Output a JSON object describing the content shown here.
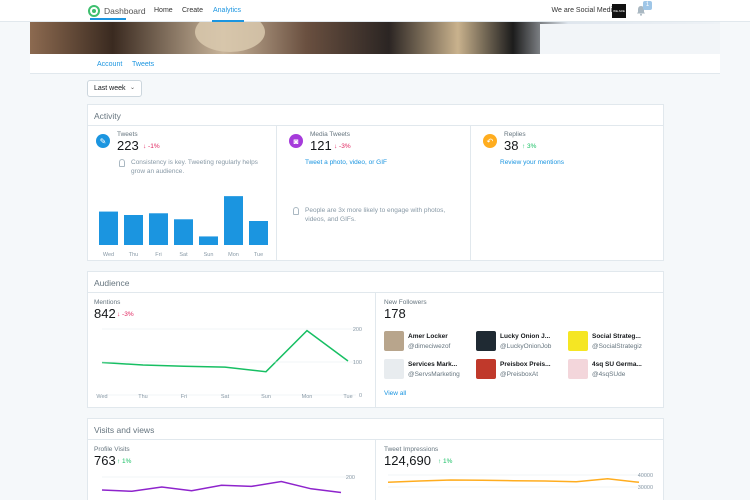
{
  "nav": {
    "brand": "Dashboard",
    "items": [
      {
        "label": "Home"
      },
      {
        "label": "Create"
      },
      {
        "label": "Analytics"
      }
    ],
    "account_name": "We are Social Media",
    "notif_count": "1",
    "avatar_text": "WE ARE"
  },
  "subtabs": [
    {
      "label": "Account"
    },
    {
      "label": "Tweets"
    }
  ],
  "range_select": {
    "value": "Last week"
  },
  "activity": {
    "title": "Activity",
    "tweets": {
      "label": "Tweets",
      "value": "223",
      "delta": "↓ -1%",
      "tip": "Consistency is key. Tweeting regularly helps grow an audience."
    },
    "media": {
      "label": "Media Tweets",
      "value": "121",
      "delta": "↓ -3%",
      "link": "Tweet a photo, video, or GIF",
      "tip": "People are 3x more likely to engage with photos, videos, and GIFs."
    },
    "replies": {
      "label": "Replies",
      "value": "38",
      "delta": "↑ 3%",
      "link": "Review your mentions"
    }
  },
  "audience": {
    "title": "Audience",
    "mentions": {
      "label": "Mentions",
      "value": "842",
      "delta": "↓ -3%"
    },
    "followers": {
      "label": "New Followers",
      "value": "178",
      "list": [
        {
          "name": "Amer Locker",
          "handle": "@dimeciwezof"
        },
        {
          "name": "Lucky Onion J...",
          "handle": "@LuckyOnionJob"
        },
        {
          "name": "Social Strateg...",
          "handle": "@SocialStrategiz"
        },
        {
          "name": "Services Mark...",
          "handle": "@ServsMarketing"
        },
        {
          "name": "Preisbox Preis...",
          "handle": "@PreisboxAt"
        },
        {
          "name": "4sq SU Germa...",
          "handle": "@4sqSUde"
        }
      ],
      "view_all": "View all"
    }
  },
  "visits": {
    "title": "Visits and views",
    "profile": {
      "label": "Profile Visits",
      "value": "763",
      "delta": "↑ 1%"
    },
    "impressions": {
      "label": "Tweet Impressions",
      "value": "124,690",
      "delta": "↑ 1%"
    }
  },
  "chart_data": [
    {
      "type": "bar",
      "categories": [
        "Wed",
        "Thu",
        "Fri",
        "Sat",
        "Sun",
        "Mon",
        "Tue"
      ],
      "values": [
        39,
        35,
        37,
        30,
        10,
        57,
        28
      ],
      "ylim": [
        0,
        70
      ],
      "color": "#1b95e0"
    },
    {
      "type": "line",
      "categories": [
        "Wed",
        "Thu",
        "Fri",
        "Sat",
        "Sun",
        "Mon",
        "Tue"
      ],
      "values": [
        110,
        102,
        98,
        95,
        80,
        215,
        115
      ],
      "yticks": [
        "200",
        "100",
        "0"
      ],
      "ylim": [
        0,
        230
      ],
      "color": "#17bf63"
    },
    {
      "type": "line",
      "values": [
        90,
        80,
        115,
        85,
        130,
        120,
        160,
        100,
        70
      ],
      "yticks": [
        "200"
      ],
      "ylim": [
        0,
        230
      ],
      "color": "#8e24cc"
    },
    {
      "type": "line",
      "values": [
        28000,
        30000,
        31500,
        31000,
        30500,
        30000,
        29000,
        33500,
        28000
      ],
      "yticks": [
        "40000",
        "30000"
      ],
      "ylim": [
        0,
        42000
      ],
      "color": "#ffad1f"
    }
  ]
}
